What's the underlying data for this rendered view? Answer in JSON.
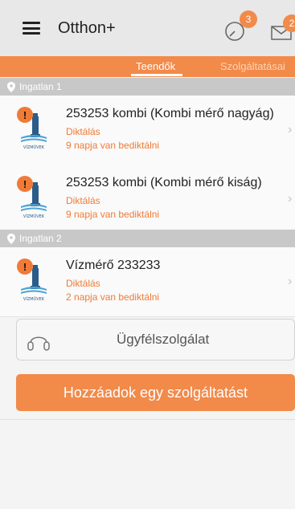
{
  "app_bar": {
    "title": "Otthon+",
    "tasks_badge": "3",
    "messages_badge": "2"
  },
  "tabs": [
    {
      "label": "Teendők",
      "active": true
    },
    {
      "label": "Szolgáltatásai",
      "active": false
    }
  ],
  "sections": [
    {
      "label": "Ingatlan 1",
      "items": [
        {
          "title": "253253 kombi (Kombi mérő nagyág)",
          "action": "Diktálás",
          "due": "9 napja van bediktálni",
          "logo_text": "VÍZMŰVEK"
        },
        {
          "title": "253253 kombi (Kombi mérő kiság)",
          "action": "Diktálás",
          "due": "9 napja van bediktálni",
          "logo_text": "VÍZMŰVEK"
        }
      ]
    },
    {
      "label": "Ingatlan 2",
      "items": [
        {
          "title": "Vízmérő  233233",
          "action": "Diktálás",
          "due": "2 napja van bediktálni",
          "logo_text": "VÍZMŰVEK"
        }
      ]
    }
  ],
  "support": {
    "label": "Ügyfélszolgálat"
  },
  "add_service": {
    "label": "Hozzáadok egy szolgáltatást"
  },
  "colors": {
    "accent": "#f28a4a",
    "alert": "#f07a36",
    "section_bg": "#c8c8c8",
    "appbar_bg": "#e8e8e8"
  },
  "icons": [
    "menu-icon",
    "timer-icon",
    "mail-icon",
    "location-pin-icon",
    "headset-icon",
    "chevron-right-icon",
    "waterworks-logo"
  ]
}
